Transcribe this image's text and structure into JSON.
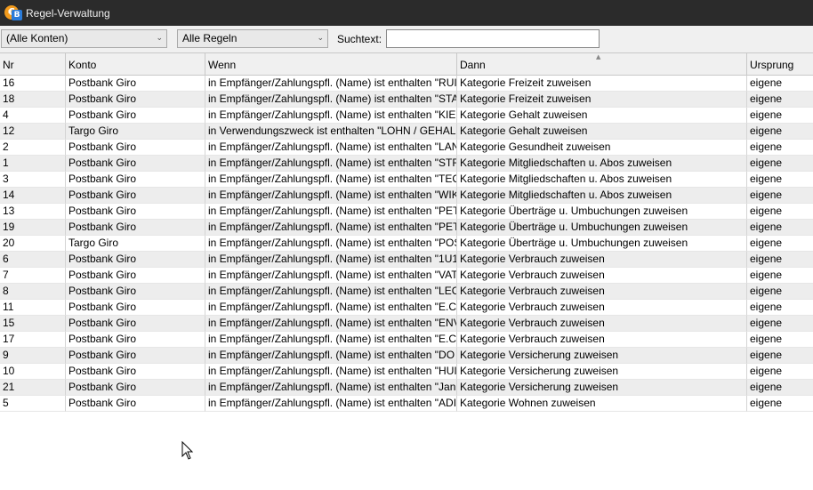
{
  "window": {
    "title": "Regel-Verwaltung"
  },
  "toolbar": {
    "account_filter": "(Alle Konten)",
    "rule_filter": "Alle Regeln",
    "search_label": "Suchtext:",
    "search_value": ""
  },
  "table": {
    "columns": [
      "Nr",
      "Konto",
      "Wenn",
      "Dann",
      "Ursprung"
    ],
    "rows": [
      [
        "16",
        "Postbank Giro",
        "in Empfänger/Zahlungspfl. (Name) ist enthalten \"RUI",
        "Kategorie Freizeit zuweisen",
        "eigene"
      ],
      [
        "18",
        "Postbank Giro",
        "in Empfänger/Zahlungspfl. (Name) ist enthalten \"STA",
        "Kategorie Freizeit zuweisen",
        "eigene"
      ],
      [
        "4",
        "Postbank Giro",
        "in Empfänger/Zahlungspfl. (Name) ist enthalten \"KIE",
        "Kategorie Gehalt zuweisen",
        "eigene"
      ],
      [
        "12",
        "Targo Giro",
        "in Verwendungszweck ist enthalten \"LOHN / GEHAL",
        "Kategorie Gehalt zuweisen",
        "eigene"
      ],
      [
        "2",
        "Postbank Giro",
        "in Empfänger/Zahlungspfl. (Name) ist enthalten \"LAN",
        "Kategorie Gesundheit zuweisen",
        "eigene"
      ],
      [
        "1",
        "Postbank Giro",
        "in Empfänger/Zahlungspfl. (Name) ist enthalten \"STF",
        "Kategorie Mitgliedschaften u. Abos zuweisen",
        "eigene"
      ],
      [
        "3",
        "Postbank Giro",
        "in Empfänger/Zahlungspfl. (Name) ist enthalten \"TEC",
        "Kategorie Mitgliedschaften u. Abos zuweisen",
        "eigene"
      ],
      [
        "14",
        "Postbank Giro",
        "in Empfänger/Zahlungspfl. (Name) ist enthalten \"WIK",
        "Kategorie Mitgliedschaften u. Abos zuweisen",
        "eigene"
      ],
      [
        "13",
        "Postbank Giro",
        "in Empfänger/Zahlungspfl. (Name) ist enthalten \"PET",
        "Kategorie Überträge u. Umbuchungen zuweisen",
        "eigene"
      ],
      [
        "19",
        "Postbank Giro",
        "in Empfänger/Zahlungspfl. (Name) ist enthalten \"PET",
        "Kategorie Überträge u. Umbuchungen zuweisen",
        "eigene"
      ],
      [
        "20",
        "Targo Giro",
        "in Empfänger/Zahlungspfl. (Name) ist enthalten \"POS",
        "Kategorie Überträge u. Umbuchungen zuweisen",
        "eigene"
      ],
      [
        "6",
        "Postbank Giro",
        "in Empfänger/Zahlungspfl. (Name) ist enthalten \"1U1",
        "Kategorie Verbrauch zuweisen",
        "eigene"
      ],
      [
        "7",
        "Postbank Giro",
        "in Empfänger/Zahlungspfl. (Name) ist enthalten \"VAT",
        "Kategorie Verbrauch zuweisen",
        "eigene"
      ],
      [
        "8",
        "Postbank Giro",
        "in Empfänger/Zahlungspfl. (Name) ist enthalten \"LEC",
        "Kategorie Verbrauch zuweisen",
        "eigene"
      ],
      [
        "11",
        "Postbank Giro",
        "in Empfänger/Zahlungspfl. (Name) ist enthalten \"E.C",
        "Kategorie Verbrauch zuweisen",
        "eigene"
      ],
      [
        "15",
        "Postbank Giro",
        "in Empfänger/Zahlungspfl. (Name) ist enthalten \"ENV",
        "Kategorie Verbrauch zuweisen",
        "eigene"
      ],
      [
        "17",
        "Postbank Giro",
        "in Empfänger/Zahlungspfl. (Name) ist enthalten \"E.C",
        "Kategorie Verbrauch zuweisen",
        "eigene"
      ],
      [
        "9",
        "Postbank Giro",
        "in Empfänger/Zahlungspfl. (Name) ist enthalten \"DO",
        "Kategorie Versicherung zuweisen",
        "eigene"
      ],
      [
        "10",
        "Postbank Giro",
        "in Empfänger/Zahlungspfl. (Name) ist enthalten \"HUI",
        "Kategorie Versicherung zuweisen",
        "eigene"
      ],
      [
        "21",
        "Postbank Giro",
        "in Empfänger/Zahlungspfl. (Name) ist enthalten \"Jan",
        "Kategorie Versicherung zuweisen",
        "eigene"
      ],
      [
        "5",
        "Postbank Giro",
        "in Empfänger/Zahlungspfl. (Name) ist enthalten \"ADI",
        "Kategorie Wohnen zuweisen",
        "eigene"
      ]
    ]
  }
}
